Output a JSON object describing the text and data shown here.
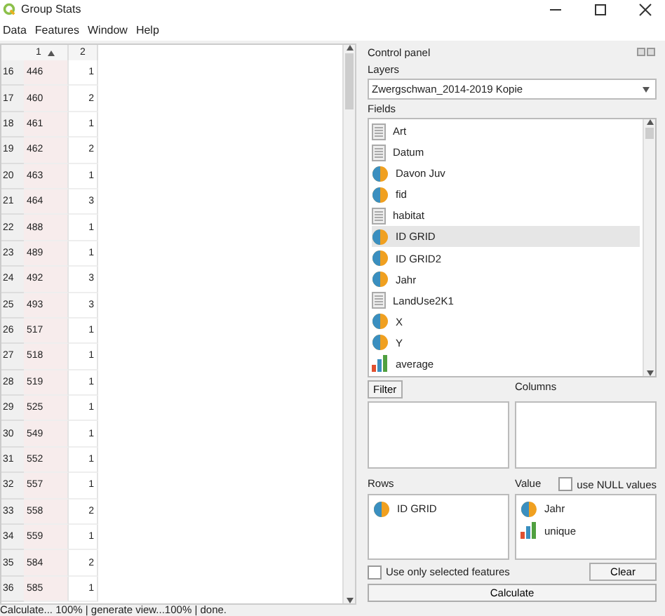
{
  "window": {
    "title": "Group Stats"
  },
  "menu": [
    "Data",
    "Features",
    "Window",
    "Help"
  ],
  "table": {
    "columns": [
      {
        "label": "1",
        "sorted": true
      },
      {
        "label": "2"
      }
    ],
    "rows": [
      {
        "header": "16",
        "cells": [
          "446",
          "1"
        ]
      },
      {
        "header": "17",
        "cells": [
          "460",
          "2"
        ]
      },
      {
        "header": "18",
        "cells": [
          "461",
          "1"
        ]
      },
      {
        "header": "19",
        "cells": [
          "462",
          "2"
        ]
      },
      {
        "header": "20",
        "cells": [
          "463",
          "1"
        ]
      },
      {
        "header": "21",
        "cells": [
          "464",
          "3"
        ]
      },
      {
        "header": "22",
        "cells": [
          "488",
          "1"
        ]
      },
      {
        "header": "23",
        "cells": [
          "489",
          "1"
        ]
      },
      {
        "header": "24",
        "cells": [
          "492",
          "3"
        ]
      },
      {
        "header": "25",
        "cells": [
          "493",
          "3"
        ]
      },
      {
        "header": "26",
        "cells": [
          "517",
          "1"
        ]
      },
      {
        "header": "27",
        "cells": [
          "518",
          "1"
        ]
      },
      {
        "header": "28",
        "cells": [
          "519",
          "1"
        ]
      },
      {
        "header": "29",
        "cells": [
          "525",
          "1"
        ]
      },
      {
        "header": "30",
        "cells": [
          "549",
          "1"
        ]
      },
      {
        "header": "31",
        "cells": [
          "552",
          "1"
        ]
      },
      {
        "header": "32",
        "cells": [
          "557",
          "1"
        ]
      },
      {
        "header": "33",
        "cells": [
          "558",
          "2"
        ]
      },
      {
        "header": "34",
        "cells": [
          "559",
          "1"
        ]
      },
      {
        "header": "35",
        "cells": [
          "584",
          "2"
        ]
      },
      {
        "header": "36",
        "cells": [
          "585",
          "1"
        ]
      }
    ]
  },
  "panel": {
    "title": "Control panel",
    "layers_label": "Layers",
    "layer": "Zwergschwan_2014-2019 Kopie",
    "fields_label": "Fields",
    "fields": [
      {
        "name": "Art",
        "kind": "text",
        "selected": false
      },
      {
        "name": "Datum",
        "kind": "text",
        "selected": false
      },
      {
        "name": "Davon Juv",
        "kind": "number",
        "selected": false
      },
      {
        "name": "fid",
        "kind": "number",
        "selected": false
      },
      {
        "name": "habitat",
        "kind": "text",
        "selected": false
      },
      {
        "name": "ID GRID",
        "kind": "number",
        "selected": true
      },
      {
        "name": "ID GRID2",
        "kind": "number",
        "selected": false
      },
      {
        "name": "Jahr",
        "kind": "number",
        "selected": false
      },
      {
        "name": "LandUse2K1",
        "kind": "text",
        "selected": false
      },
      {
        "name": "X",
        "kind": "number",
        "selected": false
      },
      {
        "name": "Y",
        "kind": "number",
        "selected": false
      },
      {
        "name": "average",
        "kind": "stat",
        "selected": false
      }
    ],
    "filter_button": "Filter",
    "columns_label": "Columns",
    "rows_label": "Rows",
    "value_label": "Value",
    "null_values": {
      "label": "use NULL values",
      "checked": false
    },
    "rows": [
      {
        "name": "ID GRID",
        "kind": "number"
      }
    ],
    "values": [
      {
        "name": "Jahr",
        "kind": "number"
      },
      {
        "name": "unique",
        "kind": "stat"
      }
    ],
    "selected_only": {
      "label": "Use only selected features",
      "checked": false
    },
    "clear_button": "Clear",
    "calculate_button": "Calculate"
  },
  "status_bar": "Calculate... 100% |  generate view...100% |  done."
}
